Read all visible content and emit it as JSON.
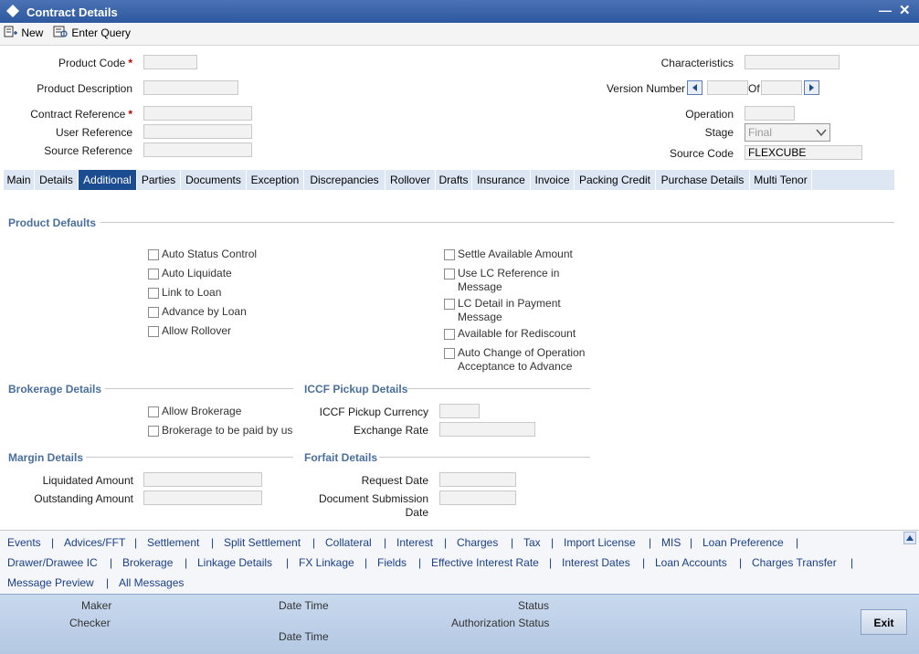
{
  "window": {
    "title": "Contract Details",
    "minimize_label": "—",
    "close_label": "✕"
  },
  "toolbar": {
    "new_label": "New",
    "enter_query_label": "Enter Query"
  },
  "header": {
    "product_code_label": "Product Code",
    "product_code_value": "",
    "product_description_label": "Product Description",
    "product_description_value": "",
    "contract_reference_label": "Contract Reference",
    "contract_reference_value": "",
    "user_reference_label": "User Reference",
    "user_reference_value": "",
    "source_reference_label": "Source Reference",
    "source_reference_value": "",
    "required_mark": "*",
    "characteristics_label": "Characteristics",
    "characteristics_value": "",
    "version_number_label": "Version Number",
    "version_number_value": "",
    "of_label": "Of",
    "of_value": "",
    "operation_label": "Operation",
    "operation_value": "",
    "stage_label": "Stage",
    "stage_value": "Final",
    "source_code_label": "Source Code",
    "source_code_value": "FLEXCUBE"
  },
  "tabs": [
    {
      "label": "Main"
    },
    {
      "label": "Details"
    },
    {
      "label": "Additional"
    },
    {
      "label": "Parties"
    },
    {
      "label": "Documents"
    },
    {
      "label": "Exception"
    },
    {
      "label": "Discrepancies"
    },
    {
      "label": "Rollover"
    },
    {
      "label": "Drafts"
    },
    {
      "label": "Insurance"
    },
    {
      "label": "Invoice"
    },
    {
      "label": "Packing Credit"
    },
    {
      "label": "Purchase Details"
    },
    {
      "label": "Multi Tenor"
    }
  ],
  "active_tab": "Additional",
  "product_defaults": {
    "title": "Product Defaults",
    "left": [
      "Auto Status Control",
      "Auto Liquidate",
      "Link to Loan",
      "Advance by Loan",
      "Allow Rollover"
    ],
    "right": [
      {
        "line1": "Settle Available Amount",
        "line2": ""
      },
      {
        "line1": "Use LC Reference in",
        "line2": "Message"
      },
      {
        "line1": "LC Detail in Payment",
        "line2": "Message"
      },
      {
        "line1": "Available for Rediscount",
        "line2": ""
      },
      {
        "line1": "Auto Change of Operation",
        "line2": "Acceptance to Advance"
      }
    ]
  },
  "brokerage": {
    "title": "Brokerage Details",
    "items": [
      "Allow Brokerage",
      "Brokerage to be paid by us"
    ]
  },
  "iccf": {
    "title": "ICCF Pickup Details",
    "currency_label": "ICCF Pickup Currency",
    "currency_value": "",
    "exchange_rate_label": "Exchange Rate",
    "exchange_rate_value": ""
  },
  "margin": {
    "title": "Margin Details",
    "liquidated_label": "Liquidated Amount",
    "liquidated_value": "",
    "outstanding_label": "Outstanding Amount",
    "outstanding_value": ""
  },
  "forfait": {
    "title": "Forfait Details",
    "request_date_label": "Request Date",
    "request_date_value": "",
    "doc_submission_label_1": "Document Submission",
    "doc_submission_label_2": "Date",
    "doc_submission_value": ""
  },
  "sublinks": {
    "separator": "|",
    "row1": [
      "Events",
      "Advices/FFT",
      "Settlement",
      "Split Settlement",
      "Collateral",
      "Interest",
      "Charges",
      "Tax",
      "Import License",
      "MIS",
      "Loan Preference"
    ],
    "row2": [
      "Drawer/Drawee IC",
      "Brokerage",
      "Linkage Details",
      "FX Linkage",
      "Fields",
      "Effective Interest Rate",
      "Interest Dates",
      "Loan Accounts",
      "Charges Transfer"
    ],
    "row3": [
      "Message Preview",
      "All Messages"
    ]
  },
  "footer": {
    "maker_label": "Maker",
    "checker_label": "Checker",
    "date_time_label_1": "Date Time",
    "date_time_label_2": "Date Time",
    "status_label": "Status",
    "authorization_status_label": "Authorization Status",
    "exit_label": "Exit"
  }
}
